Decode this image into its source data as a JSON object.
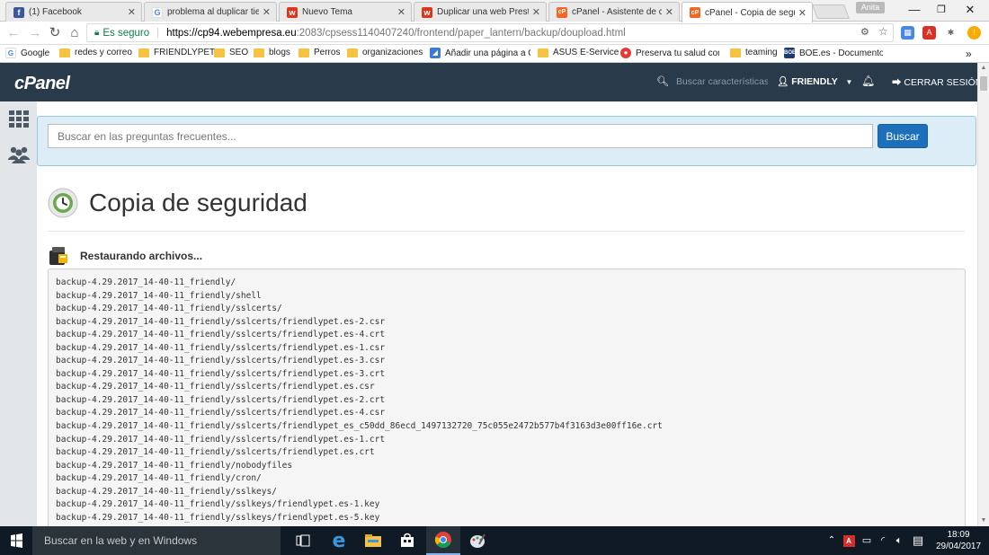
{
  "browser": {
    "tabs": [
      {
        "title": "(1) Facebook",
        "icon": "facebook-icon",
        "color": "#3b5998",
        "glyph": "f"
      },
      {
        "title": "problema al duplicar tie",
        "icon": "google-icon",
        "color": "#4285f4",
        "glyph": "G"
      },
      {
        "title": "Nuevo Tema",
        "icon": "webempresa-icon",
        "color": "#d9381e",
        "glyph": "w"
      },
      {
        "title": "Duplicar una web Presta",
        "icon": "webempresa-icon",
        "color": "#d9381e",
        "glyph": "w"
      },
      {
        "title": "cPanel - Asistente de co",
        "icon": "cpanel-icon",
        "color": "#f26722",
        "glyph": "cP"
      },
      {
        "title": "cPanel - Copia de segu",
        "icon": "cpanel-icon",
        "color": "#f26722",
        "glyph": "cP"
      }
    ],
    "profile_name": "Anita",
    "address": {
      "secure_label": "Es seguro",
      "url_host": "https://cp94.webempresa.eu",
      "url_rest": ":2083/cpsess1140407240/frontend/paper_lantern/backup/doupload.html"
    },
    "bookmarks": [
      {
        "label": "Google",
        "type": "google"
      },
      {
        "label": "redes y correo",
        "type": "folder"
      },
      {
        "label": "FRIENDLYPET",
        "type": "folder"
      },
      {
        "label": "SEO",
        "type": "folder"
      },
      {
        "label": "blogs",
        "type": "folder"
      },
      {
        "label": "Perros",
        "type": "folder"
      },
      {
        "label": "organizaciones",
        "type": "folder"
      },
      {
        "label": "Añadir una página a G",
        "type": "site"
      },
      {
        "label": "ASUS E-Service",
        "type": "folder"
      },
      {
        "label": "Preserva tu salud con",
        "type": "site"
      },
      {
        "label": "teaming",
        "type": "folder"
      },
      {
        "label": "BOE.es - Documento B",
        "type": "site"
      }
    ],
    "more_bookmarks": "»"
  },
  "cpanel": {
    "logo": "cPanel",
    "search_placeholder": "Buscar características",
    "user": "FRIENDLY",
    "logout": "CERRAR SESIÓN"
  },
  "main": {
    "faq_placeholder": "Buscar en las preguntas frecuentes...",
    "faq_button": "Buscar",
    "title": "Copia de seguridad",
    "status": "Restaurando archivos...",
    "log_lines": [
      "backup-4.29.2017_14-40-11_friendly/",
      "backup-4.29.2017_14-40-11_friendly/shell",
      "backup-4.29.2017_14-40-11_friendly/sslcerts/",
      "backup-4.29.2017_14-40-11_friendly/sslcerts/friendlypet.es-2.csr",
      "backup-4.29.2017_14-40-11_friendly/sslcerts/friendlypet.es-4.crt",
      "backup-4.29.2017_14-40-11_friendly/sslcerts/friendlypet.es-1.csr",
      "backup-4.29.2017_14-40-11_friendly/sslcerts/friendlypet.es-3.csr",
      "backup-4.29.2017_14-40-11_friendly/sslcerts/friendlypet.es-3.crt",
      "backup-4.29.2017_14-40-11_friendly/sslcerts/friendlypet.es.csr",
      "backup-4.29.2017_14-40-11_friendly/sslcerts/friendlypet.es-2.crt",
      "backup-4.29.2017_14-40-11_friendly/sslcerts/friendlypet.es-4.csr",
      "backup-4.29.2017_14-40-11_friendly/sslcerts/friendlypet_es_c50dd_86ecd_1497132720_75c055e2472b577b4f3163d3e00ff16e.crt",
      "backup-4.29.2017_14-40-11_friendly/sslcerts/friendlypet.es-1.crt",
      "backup-4.29.2017_14-40-11_friendly/sslcerts/friendlypet.es.crt",
      "backup-4.29.2017_14-40-11_friendly/nobodyfiles",
      "backup-4.29.2017_14-40-11_friendly/cron/",
      "backup-4.29.2017_14-40-11_friendly/sslkeys/",
      "backup-4.29.2017_14-40-11_friendly/sslkeys/friendlypet.es-1.key",
      "backup-4.29.2017_14-40-11_friendly/sslkeys/friendlypet.es-5.key"
    ]
  },
  "taskbar": {
    "search_placeholder": "Buscar en la web y en Windows",
    "time": "18:09",
    "date": "29/04/2017"
  },
  "colors": {
    "cpanel_header": "#293a4a",
    "faq_bg": "#dcedf8",
    "button_blue": "#1c6fb8",
    "sidebar": "#e3e6e8",
    "taskbar": "#101a24"
  }
}
